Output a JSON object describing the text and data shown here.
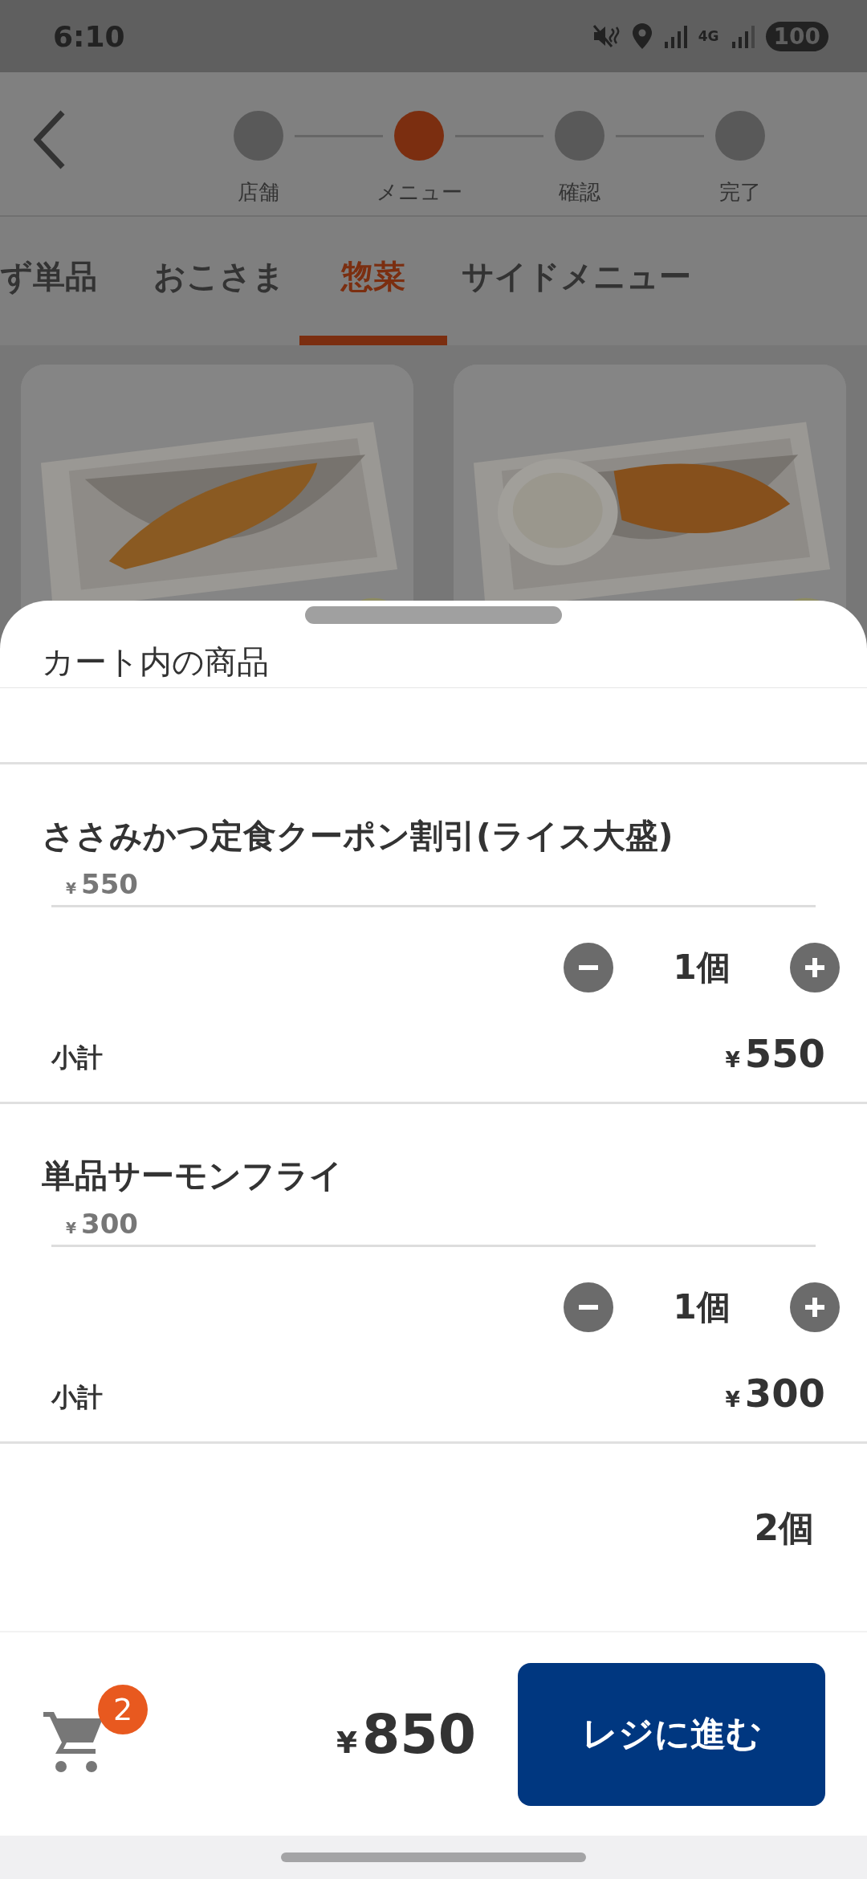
{
  "status_bar": {
    "time": "6:10",
    "network": "4G",
    "battery": "100"
  },
  "steps": [
    {
      "label": "店舗",
      "selected": false
    },
    {
      "label": "メニュー",
      "selected": true
    },
    {
      "label": "確認",
      "selected": false
    },
    {
      "label": "完了",
      "selected": false
    }
  ],
  "tabs": [
    {
      "label": "ず単品",
      "selected": false
    },
    {
      "label": "おこさま",
      "selected": false
    },
    {
      "label": "惣菜",
      "selected": true
    },
    {
      "label": "サイドメニュー",
      "selected": false
    }
  ],
  "cart": {
    "title": "カート内の商品",
    "items": [
      {
        "name": "ささみかつ定食クーポン割引(ライス大盛)",
        "currency": "¥",
        "price": "550",
        "quantity": "1個",
        "subtotal_label": "小計",
        "subtotal_currency": "¥",
        "subtotal": "550"
      },
      {
        "name": "単品サーモンフライ",
        "currency": "¥",
        "price": "300",
        "quantity": "1個",
        "subtotal_label": "小計",
        "subtotal_currency": "¥",
        "subtotal": "300"
      }
    ],
    "total_quantity": "2個"
  },
  "footer": {
    "cart_count": "2",
    "total_currency": "¥",
    "total": "850",
    "checkout_button": "レジに進む"
  }
}
